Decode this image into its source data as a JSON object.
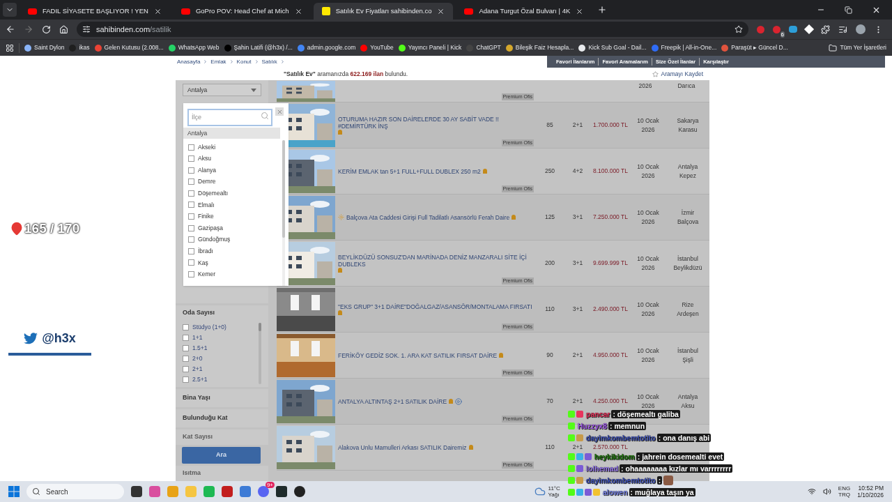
{
  "tabs": [
    {
      "title": "FADIL SİYASETE BAŞLIYOR ! YEN",
      "kind": "video",
      "selected": false
    },
    {
      "title": "GoPro POV: Head Chef at Mich",
      "kind": "video",
      "selected": false
    },
    {
      "title": "Satılık Ev Fiyatları sahibinden.co",
      "kind": "site",
      "selected": true
    },
    {
      "title": "Adana Turgut Özal Bulvarı | 4K",
      "kind": "video",
      "selected": false
    }
  ],
  "address": {
    "host": "sahibinden.com",
    "path": "/satilik"
  },
  "extension_badge": "6",
  "bookmarks": [
    {
      "label": "Saint Dylon",
      "color": "#8ab4f8"
    },
    {
      "label": "ikas",
      "color": "#1f1f1f"
    },
    {
      "label": "Gelen Kutusu (2.008...",
      "color": "#ea4335"
    },
    {
      "label": "WhatsApp Web",
      "color": "#25d366"
    },
    {
      "label": "Şahin Latifi (@h3x) /...",
      "color": "#000000"
    },
    {
      "label": "admin.google.com",
      "color": "#4285f4"
    },
    {
      "label": "YouTube",
      "color": "#ff0000"
    },
    {
      "label": "Yayıncı Paneli | Kick",
      "color": "#53fc18"
    },
    {
      "label": "ChatGPT",
      "color": "#444444"
    },
    {
      "label": "Bileşik Faiz Hesapla...",
      "color": "#d4a72c"
    },
    {
      "label": "Kick Sub Goal - Dail...",
      "color": "#e8eaed"
    },
    {
      "label": "Freepik | All-in-One...",
      "color": "#2f6cf6"
    },
    {
      "label": "Paraşüt ▸ Güncel D...",
      "color": "#e0533d"
    }
  ],
  "all_bookmarks": "Tüm Yer İşaretleri",
  "breadcrumb": [
    "Anasayfa",
    "Emlak",
    "Konut",
    "Satılık"
  ],
  "top_links": [
    "Favori İlanlarım",
    "Favori Aramalarım",
    "Size Özel İlanlar",
    "Karşılaştır"
  ],
  "result_text": "**\"Satılık Ev\"** aramanızda **622.169 ilan** bulundu.",
  "save_search": "Aramayı Kaydet",
  "city_select": "Antalya",
  "district_dropdown": {
    "placeholder": "İlçe",
    "group": "Antalya",
    "items": [
      {
        "label": "Akseki",
        "checked": false
      },
      {
        "label": "Aksu",
        "checked": false
      },
      {
        "label": "Alanya",
        "checked": false
      },
      {
        "label": "Demre",
        "checked": false
      },
      {
        "label": "Döşemealtı",
        "checked": false
      },
      {
        "label": "Elmalı",
        "checked": false
      },
      {
        "label": "Finike",
        "checked": false
      },
      {
        "label": "Gazipaşa",
        "checked": false
      },
      {
        "label": "Gündoğmuş",
        "checked": false
      },
      {
        "label": "İbradı",
        "checked": false
      },
      {
        "label": "Kaş",
        "checked": false
      },
      {
        "label": "Kemer",
        "checked": false
      }
    ]
  },
  "room_filter": {
    "title": "Oda Sayısı",
    "items": [
      {
        "label": "Stüdyo (1+0)",
        "checked": false
      },
      {
        "label": "1+1",
        "checked": false
      },
      {
        "label": "1.5+1",
        "checked": false
      },
      {
        "label": "2+0",
        "checked": false
      },
      {
        "label": "2+1",
        "checked": false
      },
      {
        "label": "2.5+1",
        "checked": false
      }
    ]
  },
  "filter_sections": [
    "Bina Yaşı",
    "Bulunduğu Kat",
    "Kat Sayısı",
    "Isıtma"
  ],
  "search_button": "Ara",
  "cut_row": {
    "date": "2026",
    "location": "Darıca",
    "badge": "Premium Ofis"
  },
  "listings": [
    {
      "title": "OTURUMA HAZIR SON DAİRELERDE 30 AY SABİT VADE !! #DEMİRTÜRK İNŞ",
      "featured": false,
      "video": false,
      "m2": "85",
      "rooms": "2+1",
      "price": "1.700.000 TL",
      "date": "10 Ocak 2026",
      "city": "Sakarya",
      "district": "Karasu",
      "badge": "Premium Ofis"
    },
    {
      "title": "KERİM EMLAK tan 5+1 FULL+FULL DUBLEX 250 m2",
      "featured": false,
      "video": false,
      "m2": "250",
      "rooms": "4+2",
      "price": "8.100.000 TL",
      "date": "10 Ocak 2026",
      "city": "Antalya",
      "district": "Kepez",
      "badge": "Premium Ofis"
    },
    {
      "title": "Balçova Ata Caddesi Girişi Full Tadilatlı Asansörlü Ferah Daire",
      "featured": true,
      "video": false,
      "m2": "125",
      "rooms": "3+1",
      "price": "7.250.000 TL",
      "date": "10 Ocak 2026",
      "city": "İzmir",
      "district": "Balçova"
    },
    {
      "title": "BEYLİKDÜZÜ SONSUZ'DAN MARİNADA DENİZ MANZARALI SİTE İÇİ DUBLEKS",
      "featured": false,
      "video": false,
      "m2": "200",
      "rooms": "3+1",
      "price": "9.699.999 TL",
      "date": "10 Ocak 2026",
      "city": "İstanbul",
      "district": "Beylikdüzü",
      "badge": "Premium Ofis"
    },
    {
      "title": "\"EKS GRUP\" 3+1 DAİRE\"DOĞALGAZ/ASANSÖR/MONTALAMA FIRSATI",
      "featured": false,
      "video": false,
      "m2": "110",
      "rooms": "3+1",
      "price": "2.490.000 TL",
      "date": "10 Ocak 2026",
      "city": "Rize",
      "district": "Ardeşen",
      "badge": "Premium Ofis"
    },
    {
      "title": "FERİKÖY GEDİZ SOK. 1. ARA KAT SATILIK FIRSAT DAİRE",
      "featured": false,
      "video": false,
      "m2": "90",
      "rooms": "2+1",
      "price": "4.950.000 TL",
      "date": "10 Ocak 2026",
      "city": "İstanbul",
      "district": "Şişli",
      "badge": "Premium Ofis"
    },
    {
      "title": "ANTALYA ALTINTAŞ 2+1 SATILIK DAİRE",
      "featured": false,
      "video": true,
      "m2": "70",
      "rooms": "2+1",
      "price": "4.250.000 TL",
      "date": "10 Ocak 2026",
      "city": "Antalya",
      "district": "Aksu",
      "badge": "Premium Ofis"
    },
    {
      "title": "Alakova Unlu Mamulleri Arkası SATILIK Dairemiz",
      "featured": false,
      "video": false,
      "m2": "110",
      "rooms": "2+1",
      "price": "2.570.000 TL",
      "badge": "Premium Ofis"
    }
  ],
  "counter": "165 / 170",
  "handle": "@h3x",
  "chat": [
    {
      "user": "pancar",
      "color": "#e8355e",
      "text": ": döşemealtı galiba",
      "badges": [
        {
          "kind": "kick"
        },
        {
          "kind": "heart"
        }
      ],
      "emote": false
    },
    {
      "user": "Huzzyx8",
      "color": "#a55cf0",
      "text": ": memnun",
      "badges": [
        {
          "kind": "kick"
        }
      ],
      "emote": false
    },
    {
      "user": "dayimkombemtotito",
      "color": "#3f52b8",
      "text": ": ona danış abi",
      "badges": [
        {
          "kind": "kick"
        },
        {
          "kind": "gift"
        }
      ],
      "emote": false
    },
    {
      "user": "heykikidom",
      "color": "#1f7a0c",
      "text": ": jahrein dosemealti evet",
      "badges": [
        {
          "kind": "kick"
        },
        {
          "kind": "cube"
        },
        {
          "kind": "gem"
        }
      ],
      "emote": false
    },
    {
      "user": "lolhemad",
      "color": "#9b7cf2",
      "text": ": ohaaaaaaaa kızlar mı varrrrrrrr",
      "badges": [
        {
          "kind": "kick"
        },
        {
          "kind": "gem"
        }
      ],
      "emote": false
    },
    {
      "user": "dayimkombemtotito",
      "color": "#3f52b8",
      "text": ":",
      "badges": [
        {
          "kind": "kick"
        },
        {
          "kind": "gift"
        }
      ],
      "emote": true
    },
    {
      "user": "alowen",
      "color": "#7a86e8",
      "text": ": muğlaya taşın ya",
      "badges": [
        {
          "kind": "kick"
        },
        {
          "kind": "cube"
        },
        {
          "kind": "gem"
        },
        {
          "kind": "crown"
        }
      ],
      "emote": false
    }
  ],
  "taskbar": {
    "search": "Search",
    "discord_badge": "9+",
    "temperature": "11°C",
    "weather": "Yağı",
    "lang": "ENG",
    "layout": "TRQ",
    "time": "10:52 PM",
    "date": "1/10/2026"
  }
}
